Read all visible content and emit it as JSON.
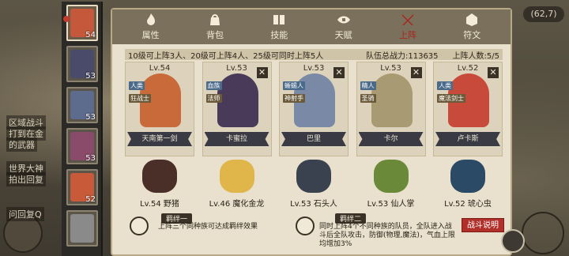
{
  "world": {
    "coordinate": "(62,7)",
    "chat_lines": [
      "区域战斗",
      "打到在金",
      "的武器",
      "世界大神",
      "拍出回复",
      "问回复Q"
    ]
  },
  "hero_strip": [
    {
      "level": "54",
      "color": "#c5583a",
      "active": true
    },
    {
      "level": "53",
      "color": "#4a4a6a",
      "active": false
    },
    {
      "level": "53",
      "color": "#5d6b8c",
      "active": false
    },
    {
      "level": "53",
      "color": "#8a4a6a",
      "active": false
    },
    {
      "level": "52",
      "color": "#c85a3a",
      "active": false
    },
    {
      "level": "",
      "color": "#8a8a8a",
      "active": false
    }
  ],
  "tabs": [
    {
      "label": "属性",
      "icon": "fire-icon",
      "active": false
    },
    {
      "label": "背包",
      "icon": "bag-icon",
      "active": false
    },
    {
      "label": "技能",
      "icon": "book-icon",
      "active": false
    },
    {
      "label": "天赋",
      "icon": "eye-icon",
      "active": false
    },
    {
      "label": "上阵",
      "icon": "swords-icon",
      "active": true
    },
    {
      "label": "符文",
      "icon": "rune-icon",
      "active": false
    }
  ],
  "info": {
    "requirement": "10级可上阵3人、20级可上阵4人、25级可同时上阵5人",
    "power_label": "队伍总战力:113635",
    "count_label": "上阵人数:5/5"
  },
  "lineup": [
    {
      "level": "Lv.54",
      "name": "天南第一剑",
      "tags": [
        "人类",
        "狂战士"
      ],
      "color": "#c86a3a",
      "removable": false
    },
    {
      "level": "Lv.53",
      "name": "卡蜜拉",
      "tags": [
        "血族",
        "法师"
      ],
      "color": "#4a3a5a",
      "removable": true
    },
    {
      "level": "Lv.53",
      "name": "巴里",
      "tags": [
        "蜥蜴人",
        "神射手"
      ],
      "color": "#7a8aa6",
      "removable": true
    },
    {
      "level": "Lv.53",
      "name": "卡尔",
      "tags": [
        "精人",
        "圣骑"
      ],
      "color": "#a89a72",
      "removable": true
    },
    {
      "level": "Lv.52",
      "name": "卢卡斯",
      "tags": [
        "人类",
        "魔法剑士"
      ],
      "color": "#c84a3a",
      "removable": true
    }
  ],
  "pets": [
    {
      "label": "Lv.54 野猪",
      "color": "#4a2e28"
    },
    {
      "label": "Lv.46 魔化金龙",
      "color": "#e0b64a"
    },
    {
      "label": "Lv.53 石头人",
      "color": "#3a4250"
    },
    {
      "label": "Lv.53 仙人掌",
      "color": "#6a8a3a"
    },
    {
      "label": "Lv.52 琥心虫",
      "color": "#2a4a66"
    }
  ],
  "bonds": [
    {
      "title": "羁绊一",
      "desc": "上阵三个同种族可达成羁绊效果"
    },
    {
      "title": "羁绊二",
      "desc": "同时上阵4个不同种族的队员，全队进入战斗后全队攻击，防御(物理,魔法)，气血上限均增加3%"
    }
  ],
  "buttons": {
    "battle_info": "战斗说明"
  }
}
